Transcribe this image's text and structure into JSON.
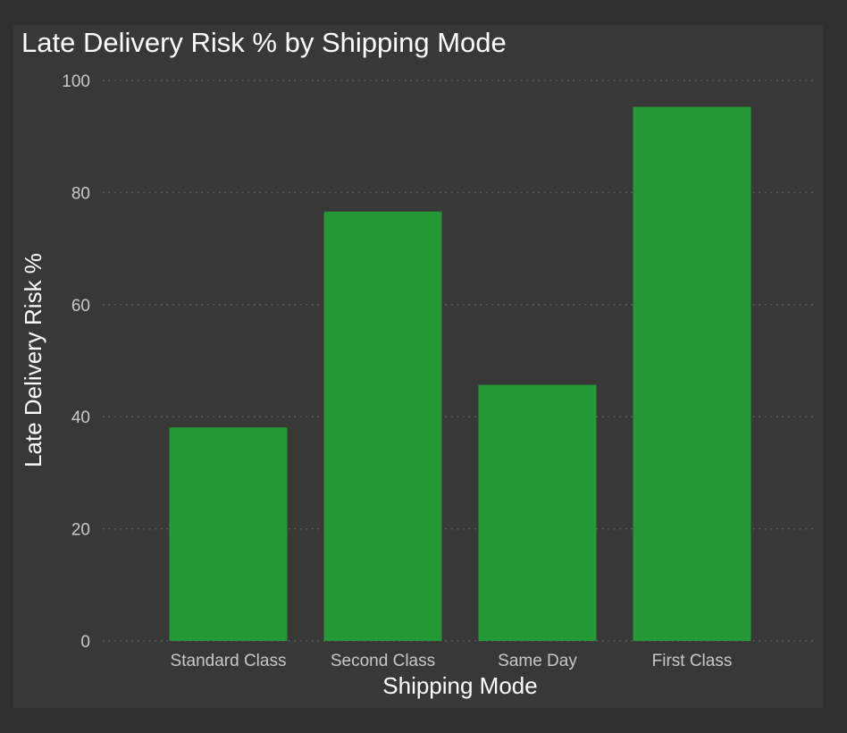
{
  "chart_data": {
    "type": "bar",
    "title": "Late Delivery Risk % by Shipping Mode",
    "xlabel": "Shipping Mode",
    "ylabel": "Late Delivery Risk %",
    "categories": [
      "Standard Class",
      "Second Class",
      "Same Day",
      "First Class"
    ],
    "values": [
      38.1,
      76.6,
      45.7,
      95.3
    ],
    "ylim": [
      0,
      100
    ],
    "yticks": [
      0,
      20,
      40,
      60,
      80,
      100
    ],
    "grid": "horizontal dotted",
    "legend": "none",
    "colors": {
      "bar": "#239834",
      "background": "#383838",
      "page": "#303030",
      "text": "#ffffff",
      "tick_text": "#c8c8c8"
    }
  }
}
